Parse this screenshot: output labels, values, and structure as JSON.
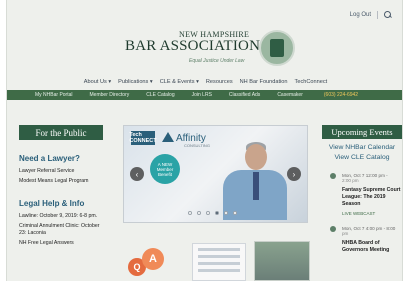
{
  "header": {
    "log_out": "Log Out",
    "search_icon": "search-icon"
  },
  "logo": {
    "line1": "NEW HAMPSHIRE",
    "line2": "BAR ASSOCIATION",
    "tagline": "Equal Justice Under Law"
  },
  "nav": {
    "items": [
      {
        "label": "About Us ▾"
      },
      {
        "label": "Publications ▾"
      },
      {
        "label": "CLE & Events ▾"
      },
      {
        "label": "Resources"
      },
      {
        "label": "NH Bar Foundation"
      },
      {
        "label": "TechConnect"
      }
    ]
  },
  "utility_bar": {
    "items": [
      {
        "label": "My NHBar Portal"
      },
      {
        "label": "Member Directory"
      },
      {
        "label": "CLE Catalog"
      },
      {
        "label": "Join LRS"
      },
      {
        "label": "Classified Ads"
      },
      {
        "label": "Casemaker"
      }
    ],
    "phone": "(603) 224-6942"
  },
  "left": {
    "box_title": "For the Public",
    "need_lawyer": {
      "heading": "Need a Lawyer?",
      "items": [
        "Lawyer Referral Service",
        "Modest Means Legal Program"
      ]
    },
    "legal_help": {
      "heading": "Legal Help & Info",
      "items": [
        "Lawline: October 9, 2019: 6-8 pm.",
        "Criminal Annulment Clinic: October 23: Laconia",
        "NH Free Legal Answers"
      ]
    }
  },
  "carousel": {
    "brand_left": "Tech CONNECT",
    "brand_right": "Affinity",
    "brand_sub": "CONSULTING",
    "badge": "A NEW Member Benefit",
    "arrow_left": "‹",
    "arrow_right": "›",
    "dots_total": 6,
    "active_dot_index": 3
  },
  "center_bottom": {
    "qa": {
      "q": "Q",
      "a": "A"
    }
  },
  "right": {
    "box_title": "Upcoming Events",
    "links": [
      "View NHBar Calendar",
      "View CLE Catalog"
    ],
    "events": [
      {
        "date": "Mon, Oct 7 12:00 pm -",
        "time2": "2:00 pm",
        "title": "Fantasy Supreme Court League: The 2019 Season",
        "tag": "LIVE WEBCAST"
      },
      {
        "date": "Mon, Oct 7 4:00 pm - 8:00",
        "time2": "pm",
        "title": "NHBA Board of Governors Meeting",
        "tag": ""
      }
    ]
  }
}
